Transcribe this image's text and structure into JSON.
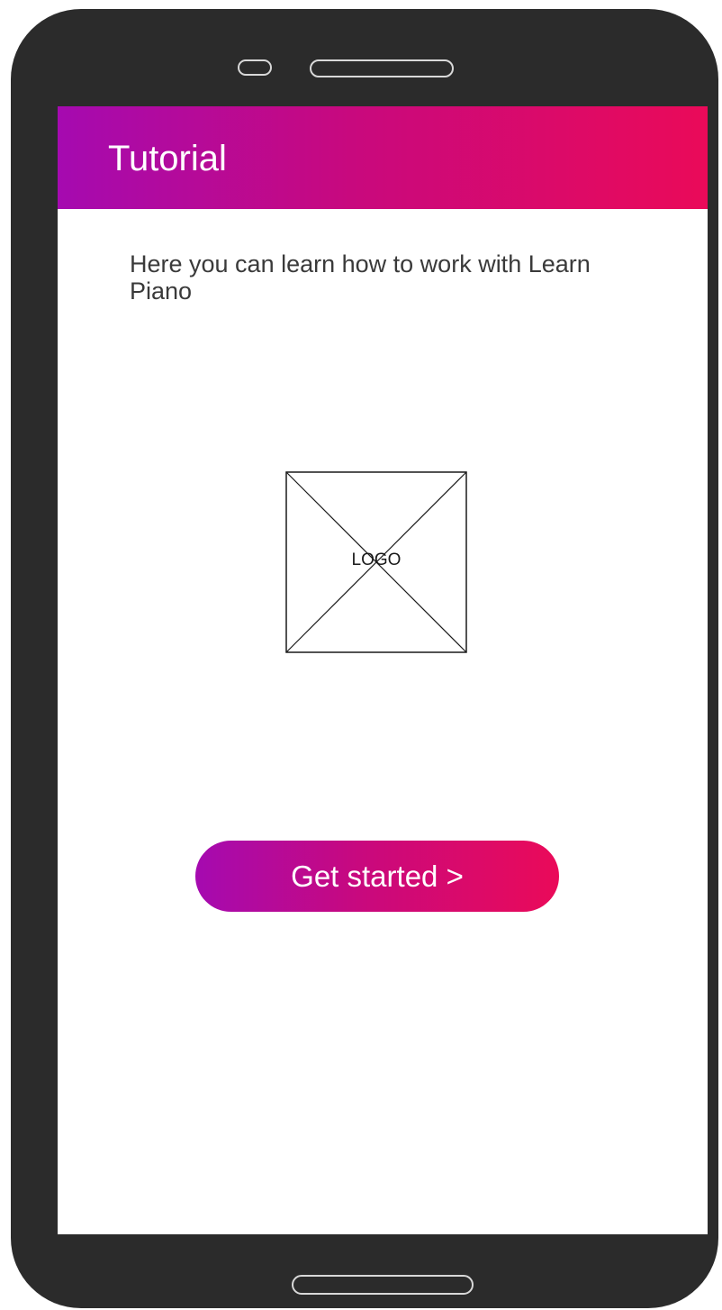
{
  "header": {
    "title": "Tutorial"
  },
  "main": {
    "intro_text": "Here you can learn how to work with Learn Piano",
    "logo_placeholder_label": "LOGO",
    "cta_label": "Get started  >"
  },
  "colors": {
    "gradient_start": "#a50ab0",
    "gradient_end": "#ea0a59",
    "device_frame": "#2b2b2b"
  }
}
